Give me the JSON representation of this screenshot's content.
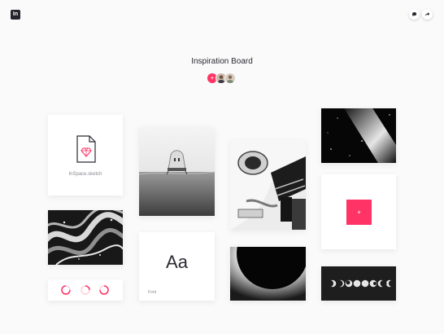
{
  "app": {
    "logo_text": "In",
    "brand_color": "#ff3366"
  },
  "header": {
    "comment_icon": "comment-icon",
    "share_icon": "share-icon"
  },
  "board": {
    "title": "Inspiration Board",
    "add_collaborator": "+",
    "collaborators": [
      "avatar-1",
      "avatar-2"
    ]
  },
  "cards": {
    "sketch_file": {
      "label": "InSpace.sketch",
      "icon": "sketch-file-icon"
    },
    "font": {
      "sample": "Aa",
      "label": "Font"
    },
    "add_card": {
      "label": "+"
    }
  }
}
